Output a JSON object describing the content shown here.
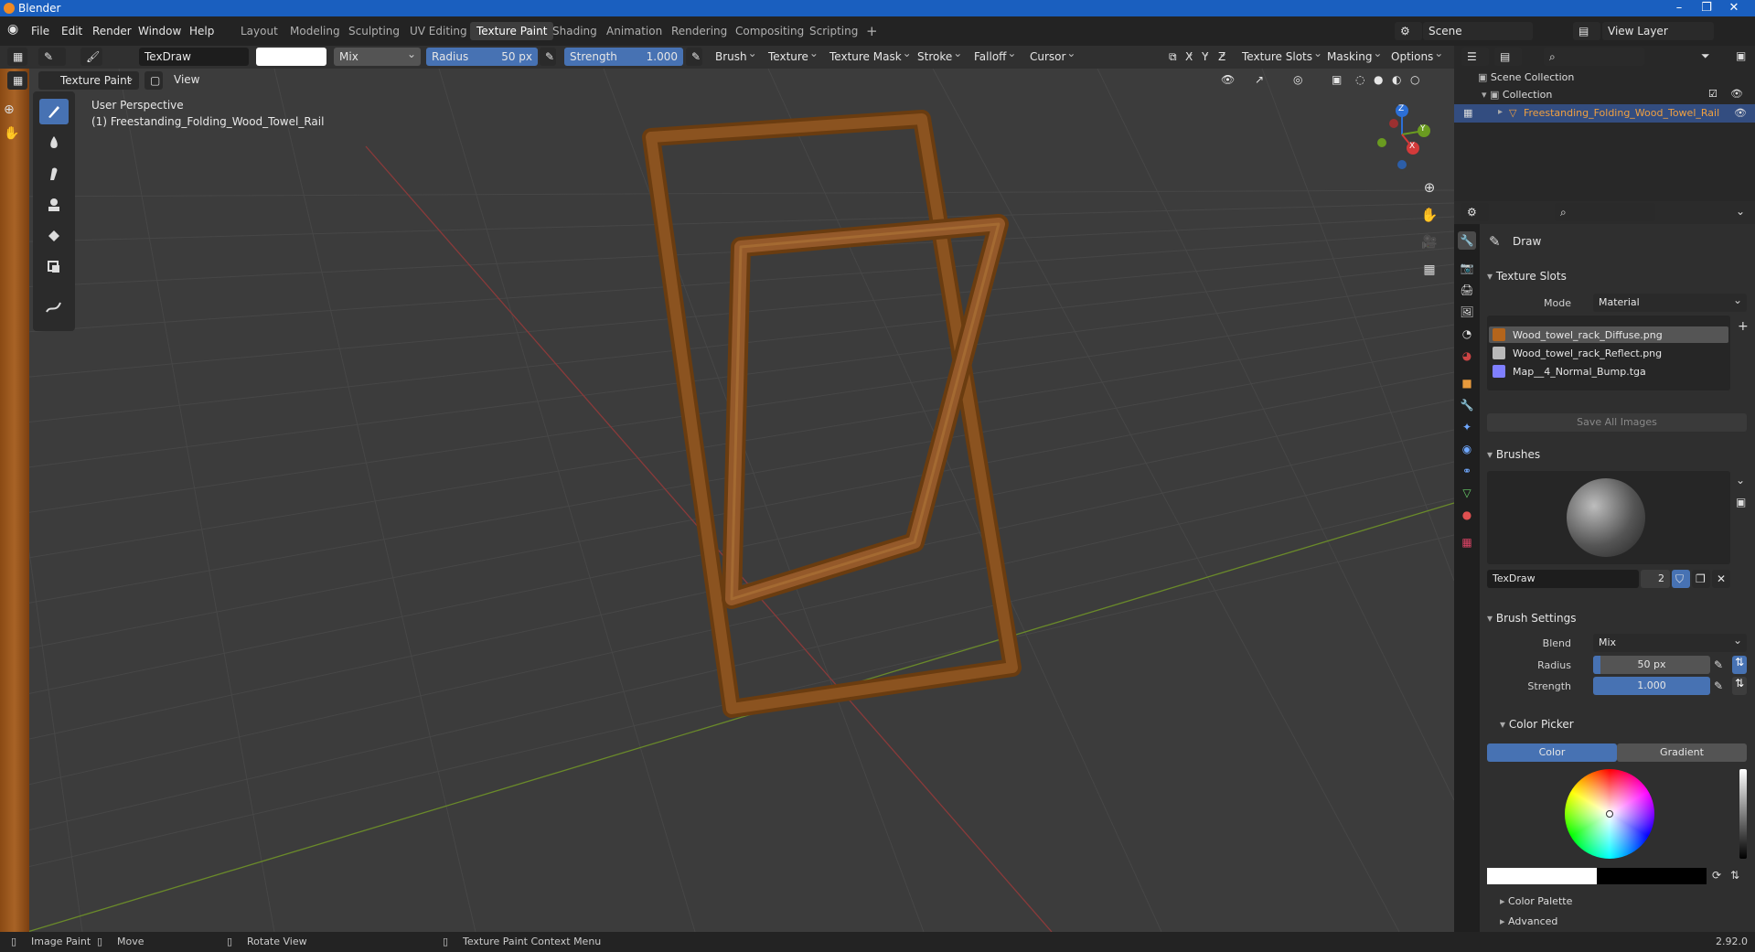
{
  "titlebar": {
    "title": "Blender"
  },
  "menus": [
    "File",
    "Edit",
    "Render",
    "Window",
    "Help"
  ],
  "workspaces": [
    "Layout",
    "Modeling",
    "Sculpting",
    "UV Editing",
    "Texture Paint",
    "Shading",
    "Animation",
    "Rendering",
    "Compositing",
    "Scripting"
  ],
  "active_workspace": "Texture Paint",
  "scene": {
    "name": "Scene",
    "view_layer": "View Layer"
  },
  "toolsettings": {
    "brush_name": "TexDraw",
    "blend": "Mix",
    "radius_label": "Radius",
    "radius_value": "50 px",
    "strength_label": "Strength",
    "strength_value": "1.000",
    "menus": [
      "Brush",
      "Texture",
      "Texture Mask",
      "Stroke",
      "Falloff",
      "Cursor"
    ],
    "axis": [
      "X",
      "Y",
      "Z"
    ],
    "right_menus": [
      "Texture Slots",
      "Masking",
      "Options"
    ]
  },
  "viewport_header": {
    "mode": "Texture Paint",
    "view": "View"
  },
  "viewport": {
    "perspective": "User Perspective",
    "object_label": "(1) Freestanding_Folding_Wood_Towel_Rail",
    "gizmo": {
      "x": "X",
      "y": "Y",
      "z": "Z"
    }
  },
  "outliner": {
    "scene_collection": "Scene Collection",
    "collection": "Collection",
    "object": "Freestanding_Folding_Wood_Towel_Rail"
  },
  "properties": {
    "tool_name": "Draw",
    "texture_slots": {
      "title": "Texture Slots",
      "mode_label": "Mode",
      "mode_value": "Material",
      "slots": [
        {
          "name": "Wood_towel_rack_Diffuse.png",
          "color": "#b4651c"
        },
        {
          "name": "Wood_towel_rack_Reflect.png",
          "color": "#b9b9b9"
        },
        {
          "name": "Map__4_Normal_Bump.tga",
          "color": "#7f7fff"
        }
      ],
      "save_all": "Save All Images"
    },
    "brushes": {
      "title": "Brushes",
      "brush": "TexDraw",
      "users": "2"
    },
    "brush_settings": {
      "title": "Brush Settings",
      "blend_label": "Blend",
      "blend_value": "Mix",
      "radius_label": "Radius",
      "radius_value": "50 px",
      "strength_label": "Strength",
      "strength_value": "1.000"
    },
    "color_picker": {
      "title": "Color Picker",
      "tab_color": "Color",
      "tab_gradient": "Gradient",
      "brush_color": "#ffffff"
    },
    "collapsed": [
      "Color Palette",
      "Advanced"
    ]
  },
  "statusbar": {
    "items": [
      "Image Paint",
      "Move",
      "Rotate View",
      "Texture Paint Context Menu"
    ],
    "version": "2.92.0"
  }
}
